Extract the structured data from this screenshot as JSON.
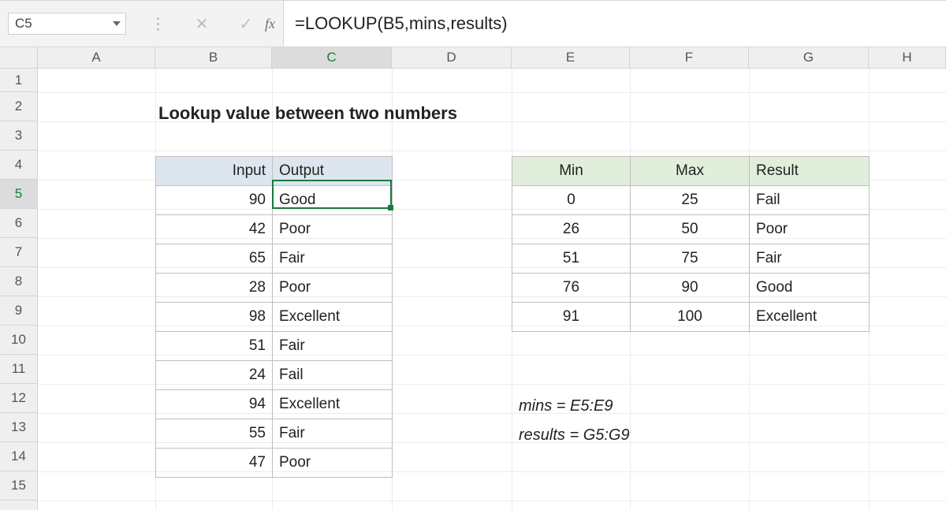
{
  "formula_bar": {
    "name_box": "C5",
    "fx_label": "fx",
    "formula": "=LOOKUP(B5,mins,results)"
  },
  "columns": [
    {
      "label": "A",
      "width": 149
    },
    {
      "label": "B",
      "width": 148
    },
    {
      "label": "C",
      "width": 152
    },
    {
      "label": "D",
      "width": 152
    },
    {
      "label": "E",
      "width": 150
    },
    {
      "label": "F",
      "width": 151
    },
    {
      "label": "G",
      "width": 152
    },
    {
      "label": "H",
      "width": 98
    }
  ],
  "rows": {
    "count": 15,
    "height": 37,
    "active": 5,
    "first_height": 30
  },
  "active": {
    "col": "C",
    "row": 5
  },
  "title": "Lookup value between two numbers",
  "io": {
    "headers": {
      "input": "Input",
      "output": "Output"
    },
    "rows": [
      {
        "input": "90",
        "output": "Good"
      },
      {
        "input": "42",
        "output": "Poor"
      },
      {
        "input": "65",
        "output": "Fair"
      },
      {
        "input": "28",
        "output": "Poor"
      },
      {
        "input": "98",
        "output": "Excellent"
      },
      {
        "input": "51",
        "output": "Fair"
      },
      {
        "input": "24",
        "output": "Fail"
      },
      {
        "input": "94",
        "output": "Excellent"
      },
      {
        "input": "55",
        "output": "Fair"
      },
      {
        "input": "47",
        "output": "Poor"
      }
    ]
  },
  "lookup": {
    "headers": {
      "min": "Min",
      "max": "Max",
      "result": "Result"
    },
    "rows": [
      {
        "min": "0",
        "max": "25",
        "result": "Fail"
      },
      {
        "min": "26",
        "max": "50",
        "result": "Poor"
      },
      {
        "min": "51",
        "max": "75",
        "result": "Fair"
      },
      {
        "min": "76",
        "max": "90",
        "result": "Good"
      },
      {
        "min": "91",
        "max": "100",
        "result": "Excellent"
      }
    ]
  },
  "notes": {
    "mins": "mins = E5:E9",
    "results": "results = G5:G9"
  }
}
